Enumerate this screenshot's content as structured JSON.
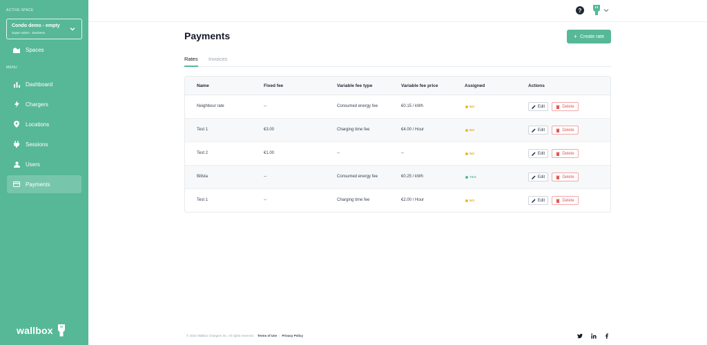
{
  "sidebar": {
    "active_space_label": "ACTIVE SPACE",
    "space_name": "Condo demo - empty",
    "space_role": "Super Admin · Business",
    "spaces_label": "Spaces",
    "menu_label": "MENU",
    "items": [
      {
        "label": "Dashboard",
        "icon": "bar-chart-icon"
      },
      {
        "label": "Chargers",
        "icon": "lightning-icon"
      },
      {
        "label": "Locations",
        "icon": "map-pin-icon"
      },
      {
        "label": "Sessions",
        "icon": "plug-icon"
      },
      {
        "label": "Users",
        "icon": "user-icon"
      },
      {
        "label": "Payments",
        "icon": "credit-card-icon"
      }
    ],
    "logo_text": "wallbox",
    "accent_color": "#56b896"
  },
  "header": {
    "help_label": "?"
  },
  "page": {
    "title": "Payments",
    "create_button": "Create rate",
    "tabs": [
      "Rates",
      "Invoices"
    ],
    "columns": [
      "Name",
      "Fixed fee",
      "Variable fee type",
      "Variable fee price",
      "Assigned",
      "Actions"
    ],
    "rows": [
      {
        "name": "Neighbour rate",
        "fixed_fee": "--",
        "fee_type": "Consumed energy fee",
        "fee_price": "€0.15 / kWh",
        "assigned": "NO"
      },
      {
        "name": "Test 1",
        "fixed_fee": "€3.00",
        "fee_type": "Charging time fee",
        "fee_price": "€4.00 / Hour",
        "assigned": "NO"
      },
      {
        "name": "Test 2",
        "fixed_fee": "€1.00",
        "fee_type": "--",
        "fee_price": "--",
        "assigned": "NO"
      },
      {
        "name": "Billsta",
        "fixed_fee": "--",
        "fee_type": "Consumed energy fee",
        "fee_price": "€0.25 / kWh",
        "assigned": "YES"
      },
      {
        "name": "Test 1",
        "fixed_fee": "--",
        "fee_type": "Charging time fee",
        "fee_price": "€2.00 / Hour",
        "assigned": "NO"
      }
    ],
    "edit_label": "Edit",
    "delete_label": "Delete"
  },
  "footer": {
    "copyright": "© 2022 Wallbox Chargers Inc. All rights reserved",
    "terms": "Terms of Use",
    "privacy": "Privacy Policy",
    "social": [
      "twitter-icon",
      "linkedin-icon",
      "facebook-icon"
    ]
  }
}
